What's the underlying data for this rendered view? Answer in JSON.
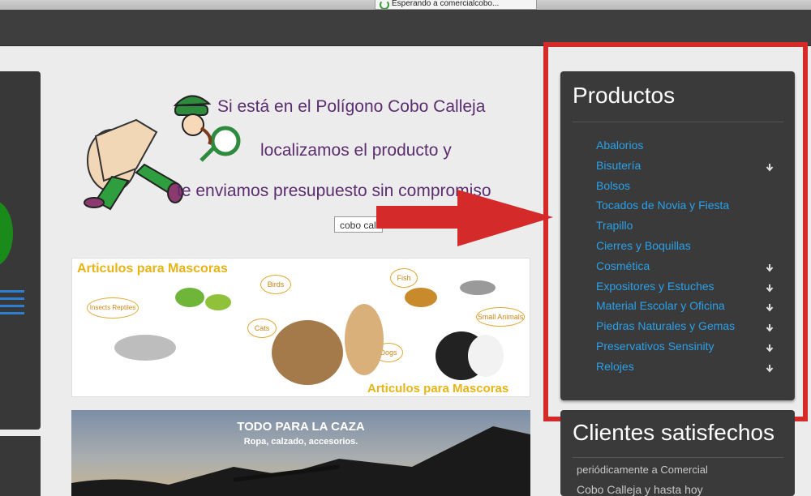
{
  "browser": {
    "tab_title": "Esperando a comercialcobo..."
  },
  "promo": {
    "line1": "Si está en el Polígono Cobo Calleja",
    "line2": "localizamos el producto y",
    "line3": "te enviamos presupuesto sin compromiso",
    "search_value": "cobo cal"
  },
  "pets_banner": {
    "title_top": "Articulos para Mascoras",
    "title_bottom": "Articulos para Mascoras",
    "bubbles": [
      "Birds",
      "Fish",
      "Insects Reptiles",
      "Cats",
      "Dogs",
      "Small Animals"
    ]
  },
  "hunt_banner": {
    "title": "TODO PARA LA CAZA",
    "subtitle": "Ropa, calzado, accesorios."
  },
  "sidebar": {
    "title": "Productos",
    "items": [
      {
        "label": "Abalorios",
        "has_submenu": false
      },
      {
        "label": "Bisutería",
        "has_submenu": true
      },
      {
        "label": "Bolsos",
        "has_submenu": false
      },
      {
        "label": "Tocados de Novia y Fiesta",
        "has_submenu": false
      },
      {
        "label": "Trapillo",
        "has_submenu": false
      },
      {
        "label": "Cierres y Boquillas",
        "has_submenu": false
      },
      {
        "label": "Cosmética",
        "has_submenu": true
      },
      {
        "label": "Expositores y Estuches",
        "has_submenu": true
      },
      {
        "label": "Material Escolar y Oficina",
        "has_submenu": true
      },
      {
        "label": "Piedras Naturales y Gemas",
        "has_submenu": true
      },
      {
        "label": "Preservativos Sensinity",
        "has_submenu": true
      },
      {
        "label": "Relojes",
        "has_submenu": true
      }
    ]
  },
  "sidebar2": {
    "title": "Clientes satisfechos",
    "text1": "periódicamente a Comercial",
    "text2": "Cobo Calleja y hasta hoy"
  },
  "colors": {
    "link": "#2aa1ea",
    "panel": "#3a3a3a",
    "highlight": "#d42a2a",
    "promo_text": "#5b2d6f",
    "pets_title": "#e7b417"
  }
}
